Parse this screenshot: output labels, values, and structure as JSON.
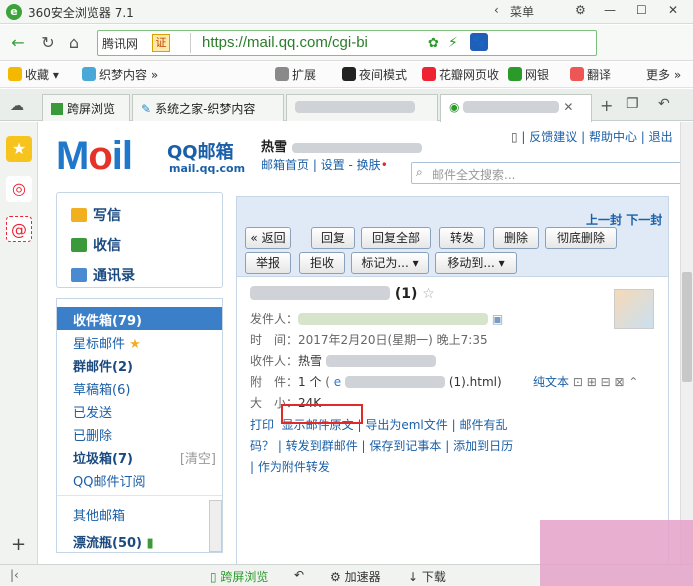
{
  "browser": {
    "title": "360安全浏览器 7.1",
    "menu_label": "菜单",
    "site_name": "腾讯网",
    "cert_badge": "证",
    "url": "https://mail.qq.com/cgi-bi",
    "bookmarks": [
      "收藏",
      "织梦内容",
      "扩展",
      "夜间模式",
      "花瓣网页收",
      "网银",
      "翻译",
      "更多"
    ],
    "tabs": [
      "跨屏浏览",
      "系统之家-织梦内容"
    ],
    "status": {
      "cross": "跨屏浏览",
      "accelerator": "加速器",
      "download": "下载"
    }
  },
  "mail": {
    "brand": "QQ邮箱",
    "domain": "mail.qq.com",
    "user_name": "热雪",
    "nav_links": [
      "邮箱首页",
      "设置",
      "换肤"
    ],
    "top_links": [
      "反馈建议",
      "帮助中心",
      "退出"
    ],
    "search_placeholder": "邮件全文搜索...",
    "compose": {
      "write": "写信",
      "receive": "收信",
      "contacts": "通讯录"
    },
    "folders": [
      {
        "label": "收件箱(79)"
      },
      {
        "label": "星标邮件"
      },
      {
        "label": "群邮件(2)"
      },
      {
        "label": "草稿箱(6)"
      },
      {
        "label": "已发送"
      },
      {
        "label": "已删除"
      },
      {
        "label": "垃圾箱(7)",
        "extra": "[清空]"
      },
      {
        "label": "QQ邮件订阅"
      },
      {
        "label": "其他邮箱"
      },
      {
        "label": "漂流瓶(50)"
      }
    ],
    "toolbar": {
      "back": "« 返回",
      "reply": "回复",
      "reply_all": "回复全部",
      "forward": "转发",
      "delete": "删除",
      "delete_forever": "彻底删除",
      "report": "举报",
      "reject": "拒收",
      "mark_as": "标记为...",
      "move_to": "移动到...",
      "prev": "上一封",
      "next": "下一封"
    },
    "message": {
      "subject_suffix": "(1)",
      "sender_label": "发件人：",
      "time_label": "时　间：",
      "time_value": "2017年2月20日(星期一) 晚上7:35",
      "recipient_label": "收件人：",
      "recipient_value": "热雪",
      "attach_label": "附　件：",
      "attach_count": "1 个",
      "attach_file": "(1).html)",
      "plain_text": "纯文本",
      "size_label": "大　小：",
      "size_value": "24K",
      "actions": [
        "打印",
        "显示邮件原文",
        "导出为eml文件",
        "邮件有乱码？",
        "转发到群邮件",
        "保存到记事本",
        "添加到日历",
        "作为附件转发"
      ]
    }
  },
  "colors": {
    "accent": "#1a5fa8",
    "highlight": "#e02a2a",
    "selected_folder": "#3a7fc8"
  }
}
